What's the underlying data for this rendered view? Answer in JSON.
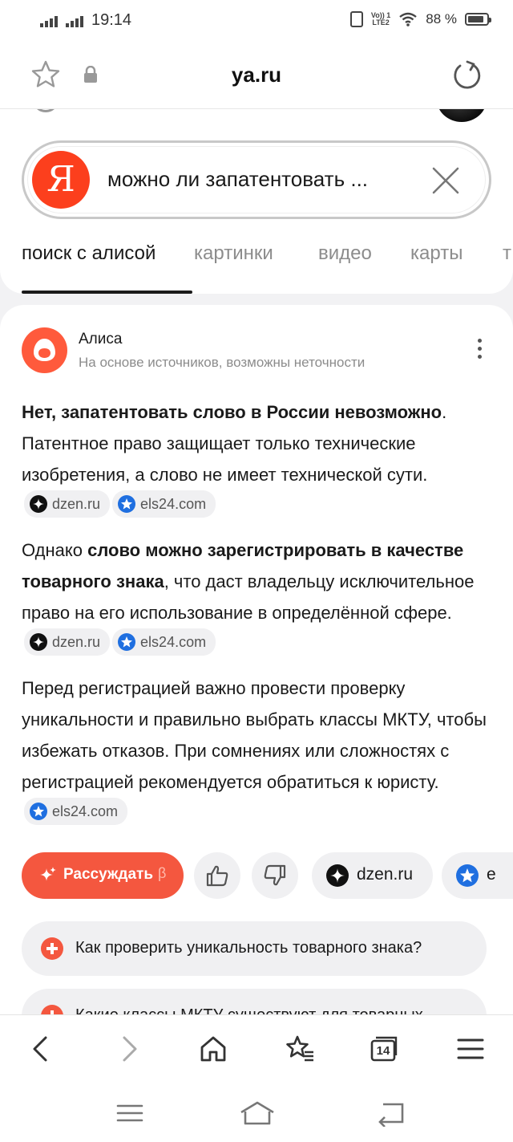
{
  "status_bar": {
    "time": "19:14",
    "lte_label_top": "Vo)) 1",
    "lte_label_bottom": "LTE2",
    "battery": "88 %",
    "battery_level": 0.88
  },
  "address_bar": {
    "domain": "ya.ru"
  },
  "search": {
    "logo_letter": "Я",
    "query": "можно ли запатентовать ...",
    "tabs": [
      "поиск с алисой",
      "картинки",
      "видео",
      "карты",
      "т"
    ],
    "active_tab": 0
  },
  "answer": {
    "author": "Алиса",
    "subtitle": "На основе источников, возможны неточности",
    "paragraphs": [
      {
        "bold": "Нет, запатентовать слово в России невозможно",
        "text": ". Патентное право защищает только технические изобретения, а слово не имеет технической сути.",
        "sources": [
          "dzen.ru",
          "els24.com"
        ]
      },
      {
        "pre": "Однако ",
        "bold": "слово можно зарегистрировать в качестве товарного знака",
        "text": ", что даст владельцу исключительное право на его использование в определённой сфере.",
        "sources": [
          "dzen.ru",
          "els24.com"
        ]
      },
      {
        "text": "Перед регистрацией важно провести проверку уникальности и правильно выбрать классы МКТУ, чтобы избежать отказов. При сомнениях или сложностях с регистрацией рекомендуется обратиться к юристу.",
        "sources": [
          "els24.com"
        ]
      }
    ],
    "actions": {
      "think_label": "Рассуждать",
      "think_badge": "β",
      "source_pills": [
        "dzen.ru",
        "e"
      ]
    },
    "suggestions": [
      "Как проверить уникальность товарного знака?",
      "Какие классы МКТУ существуют для товарных"
    ]
  },
  "toolbar": {
    "tabs_count": "14"
  },
  "colors": {
    "accent": "#f4573f",
    "yandex_red": "#fc3f1d",
    "alice": "#ff5a3c",
    "els_blue": "#1f6fe0"
  },
  "icons": [
    "star-icon",
    "lock-icon",
    "reload-icon",
    "close-icon",
    "more-icon",
    "thumb-up-icon",
    "thumb-down-icon",
    "back-icon",
    "forward-icon",
    "home-icon",
    "bookmarks-icon",
    "tabs-icon",
    "menu-icon"
  ]
}
